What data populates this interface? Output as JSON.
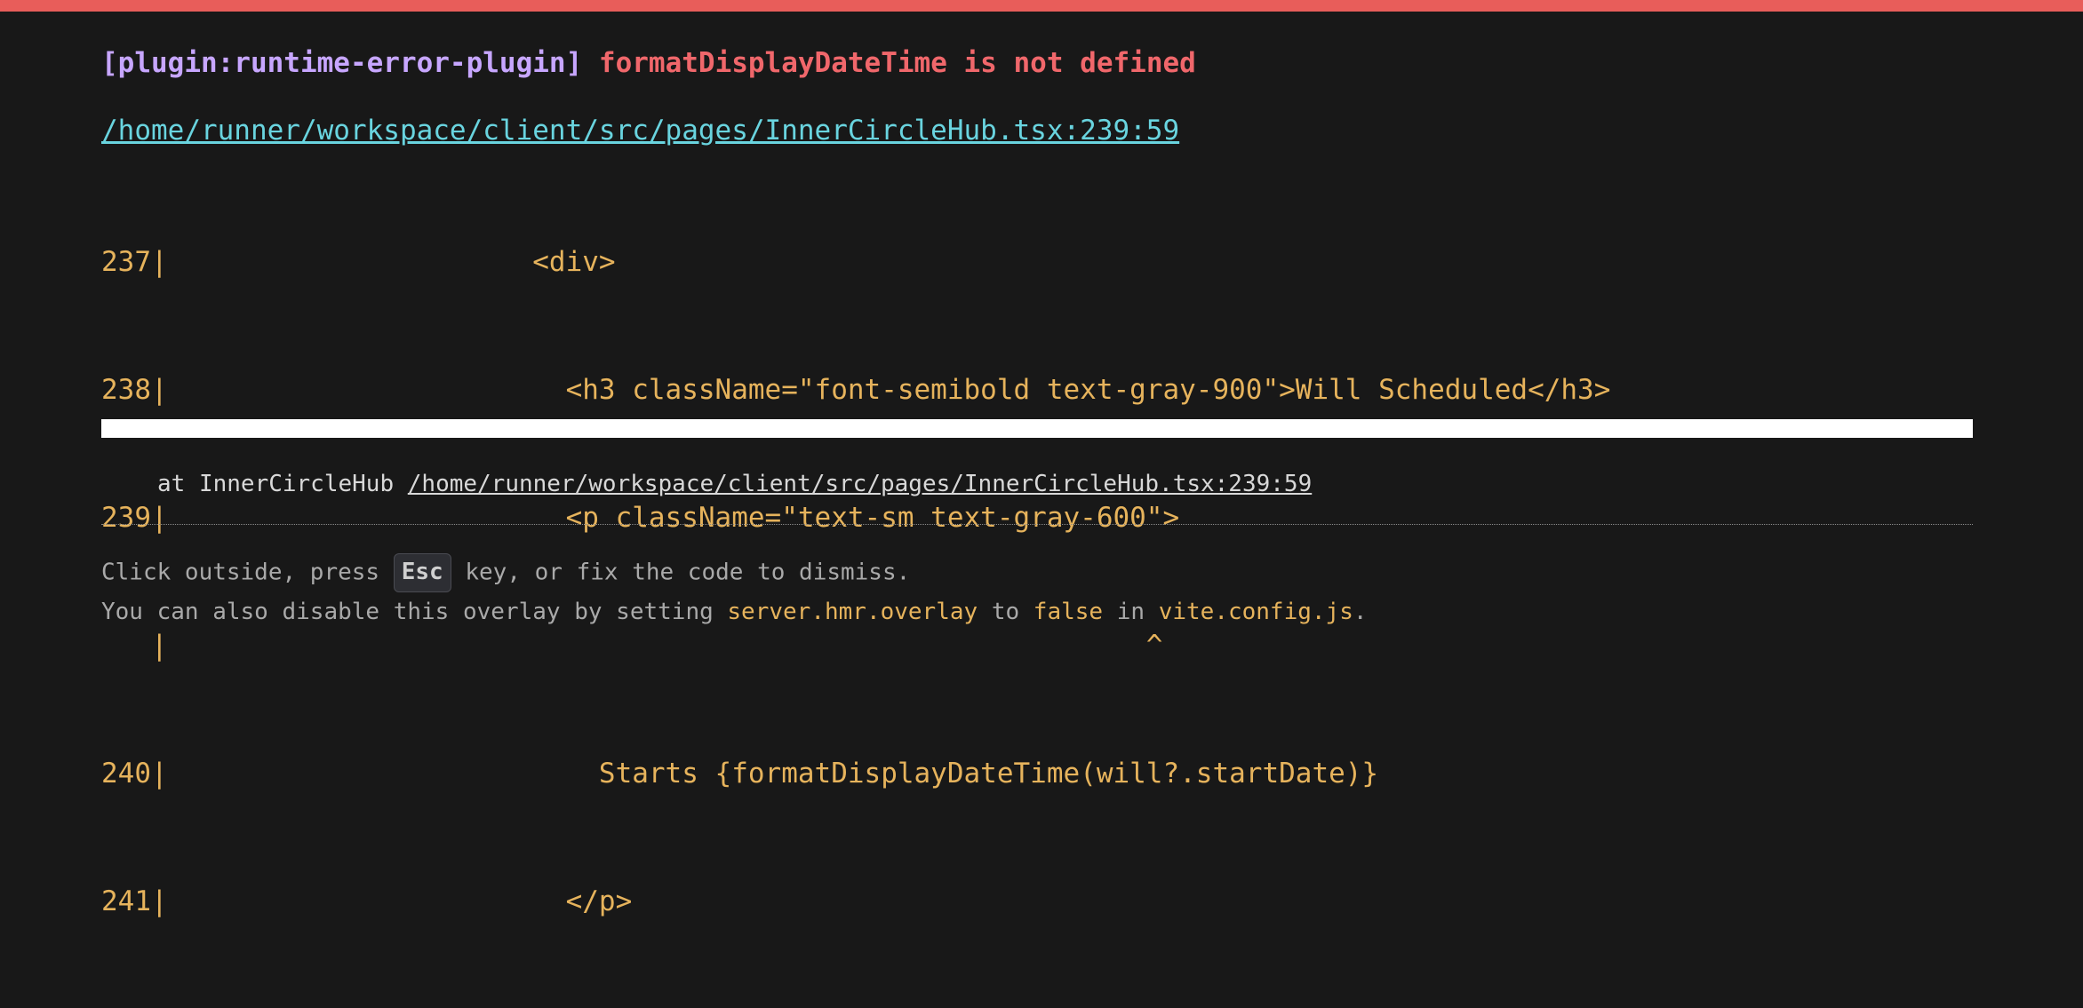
{
  "error": {
    "plugin": "[plugin:runtime-error-plugin]",
    "message": "formatDisplayDateTime is not defined",
    "file": "/home/runner/workspace/client/src/pages/InnerCircleHub.tsx:239:59"
  },
  "frame_lines": [
    "237|                      <div>",
    "238|                        <h3 className=\"font-semibold text-gray-900\">Will Scheduled</h3>",
    "239|                        <p className=\"text-sm text-gray-600\">",
    "   |                                                           ^",
    "240|                          Starts {formatDisplayDateTime(will?.startDate)}",
    "241|                        </p>"
  ],
  "stack": {
    "prefix": "at InnerCircleHub ",
    "link": "/home/runner/workspace/client/src/pages/InnerCircleHub.tsx:239:59"
  },
  "tip": {
    "line1_before": "Click outside, press ",
    "key": "Esc",
    "line1_after": " key, or fix the code to dismiss.",
    "line2_a": "You can also disable this overlay by setting ",
    "line2_b": "server.hmr.overlay",
    "line2_c": " to ",
    "line2_d": "false",
    "line2_e": " in ",
    "line2_f": "vite.config.js",
    "line2_g": "."
  },
  "colors": {
    "top_bar": "#e85d5a",
    "background": "#181818",
    "plugin": "#c7a6ff",
    "message": "#f0676b",
    "link": "#69d4df",
    "code": "#e6b35c"
  }
}
